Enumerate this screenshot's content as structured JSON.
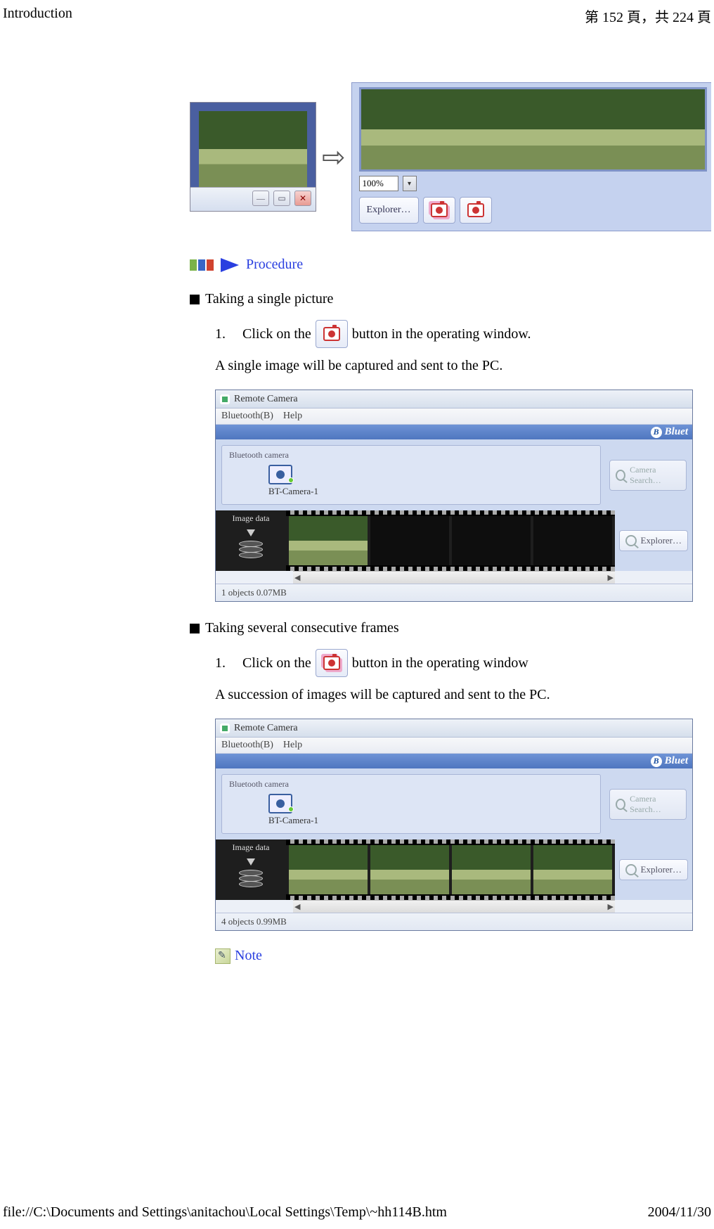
{
  "header": {
    "title": "Introduction",
    "page": "第 152 頁，共 224 頁"
  },
  "top_window": {
    "zoom": "100%",
    "explorer_btn": "Explorer…"
  },
  "procedure_label": "Procedure",
  "section1": {
    "title": "Taking a single picture",
    "step_num": "1.",
    "step_before": "Click on the",
    "step_after": "button in the operating window.",
    "step_result": "A single image will be captured and sent to the PC."
  },
  "rc": {
    "title": "Remote Camera",
    "menu_bluetooth": "Bluetooth(B)",
    "menu_help": "Help",
    "bluet_badge": "Bluet",
    "panel_label": "Bluetooth camera",
    "device": "BT-Camera-1",
    "search_btn": "Camera Search…",
    "image_data": "Image data",
    "explorer_btn": "Explorer…",
    "status1": "1 objects 0.07MB",
    "status2": "4 objects 0.99MB"
  },
  "section2": {
    "title": "Taking several consecutive frames",
    "step_num": "1.",
    "step_before": "Click on the",
    "step_after": "button in the operating window",
    "step_result": "A succession of images will be captured and sent to the PC."
  },
  "note_label": "Note",
  "footer": {
    "path": "file://C:\\Documents and Settings\\anitachou\\Local Settings\\Temp\\~hh114B.htm",
    "date": "2004/11/30"
  }
}
